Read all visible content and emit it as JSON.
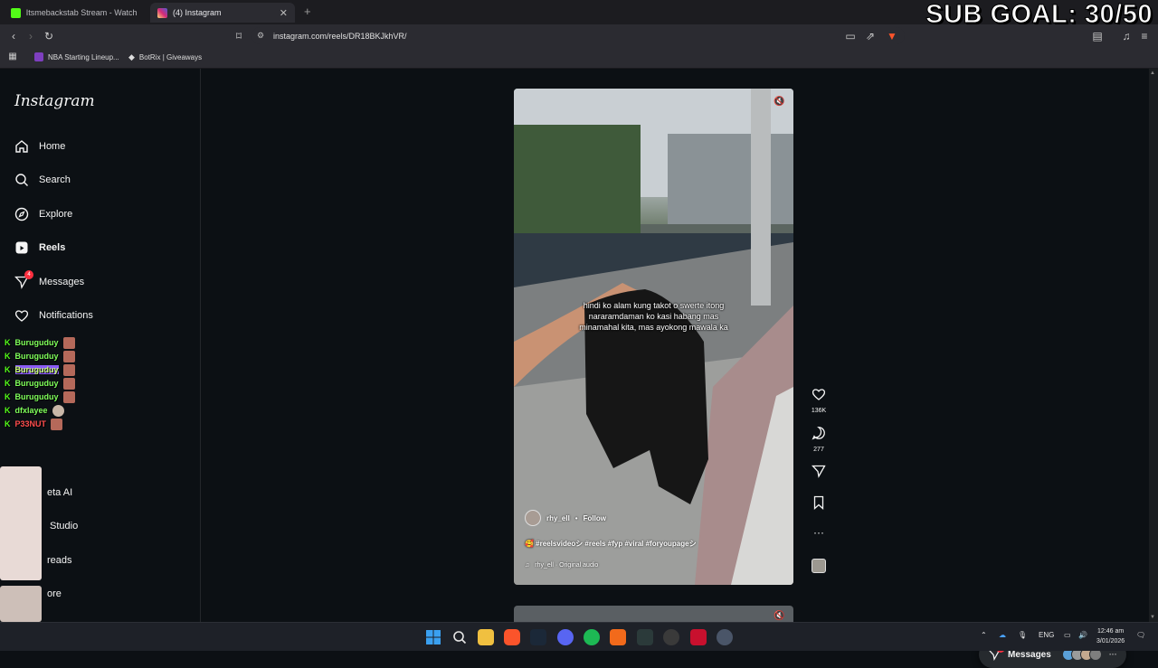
{
  "browser": {
    "tabs": [
      {
        "label": "Itsmebackstab Stream - Watch Live o",
        "active": false,
        "favicon_color": "#53fc18"
      },
      {
        "label": "(4) Instagram",
        "active": true,
        "favicon_color": "#d62976"
      }
    ],
    "url": "instagram.com/reels/DR18BKJkhVR/",
    "bookmarks": [
      {
        "label": "NBA Starting Lineup...",
        "icon_color": "#7e3fbf"
      },
      {
        "label": "BotRix | Giveaways",
        "icon_color": "#ffffff"
      }
    ]
  },
  "overlay": {
    "sub_goal": "SUB GOAL: 30/50"
  },
  "sidebar": {
    "logo": "Instagram",
    "items": [
      {
        "label": "Home",
        "icon": "home-icon"
      },
      {
        "label": "Search",
        "icon": "search-icon"
      },
      {
        "label": "Explore",
        "icon": "compass-icon"
      },
      {
        "label": "Reels",
        "icon": "reels-icon"
      },
      {
        "label": "Messages",
        "icon": "messages-icon",
        "badge": "4"
      },
      {
        "label": "Notifications",
        "icon": "heart-icon"
      }
    ],
    "more_items": [
      {
        "label": "eta AI"
      },
      {
        "label": "Studio"
      },
      {
        "label": "reads"
      },
      {
        "label": "ore"
      }
    ]
  },
  "chat": {
    "messages": [
      {
        "user": "Buruguduy",
        "highlight": false
      },
      {
        "user": "Buruguduy",
        "highlight": false
      },
      {
        "user": "Buruguduy",
        "highlight": true
      },
      {
        "user": "Buruguduy",
        "highlight": false
      },
      {
        "user": "Buruguduy",
        "highlight": false
      },
      {
        "user": "dfxlayee",
        "highlight": false
      },
      {
        "user": "P33NUT",
        "highlight": false
      }
    ]
  },
  "reel": {
    "caption_overlay": "hindi ko alam kung takot o swerte itong nararamdaman ko kasi habang mas minamahal kita, mas ayokong mawala ka",
    "username": "rhy_ell",
    "follow_label": "Follow",
    "hashtags": "🥰 #reelsvideoシ #reels #fyp #viral #foryoupageシ",
    "audio": "rhy_ell · Original audio",
    "likes": "136K",
    "comments": "277"
  },
  "messages_pill": {
    "label": "Messages",
    "badge": "4"
  },
  "taskbar": {
    "tray_lang": "ENG",
    "time": "12:46 am",
    "date": "3/01/2026"
  }
}
